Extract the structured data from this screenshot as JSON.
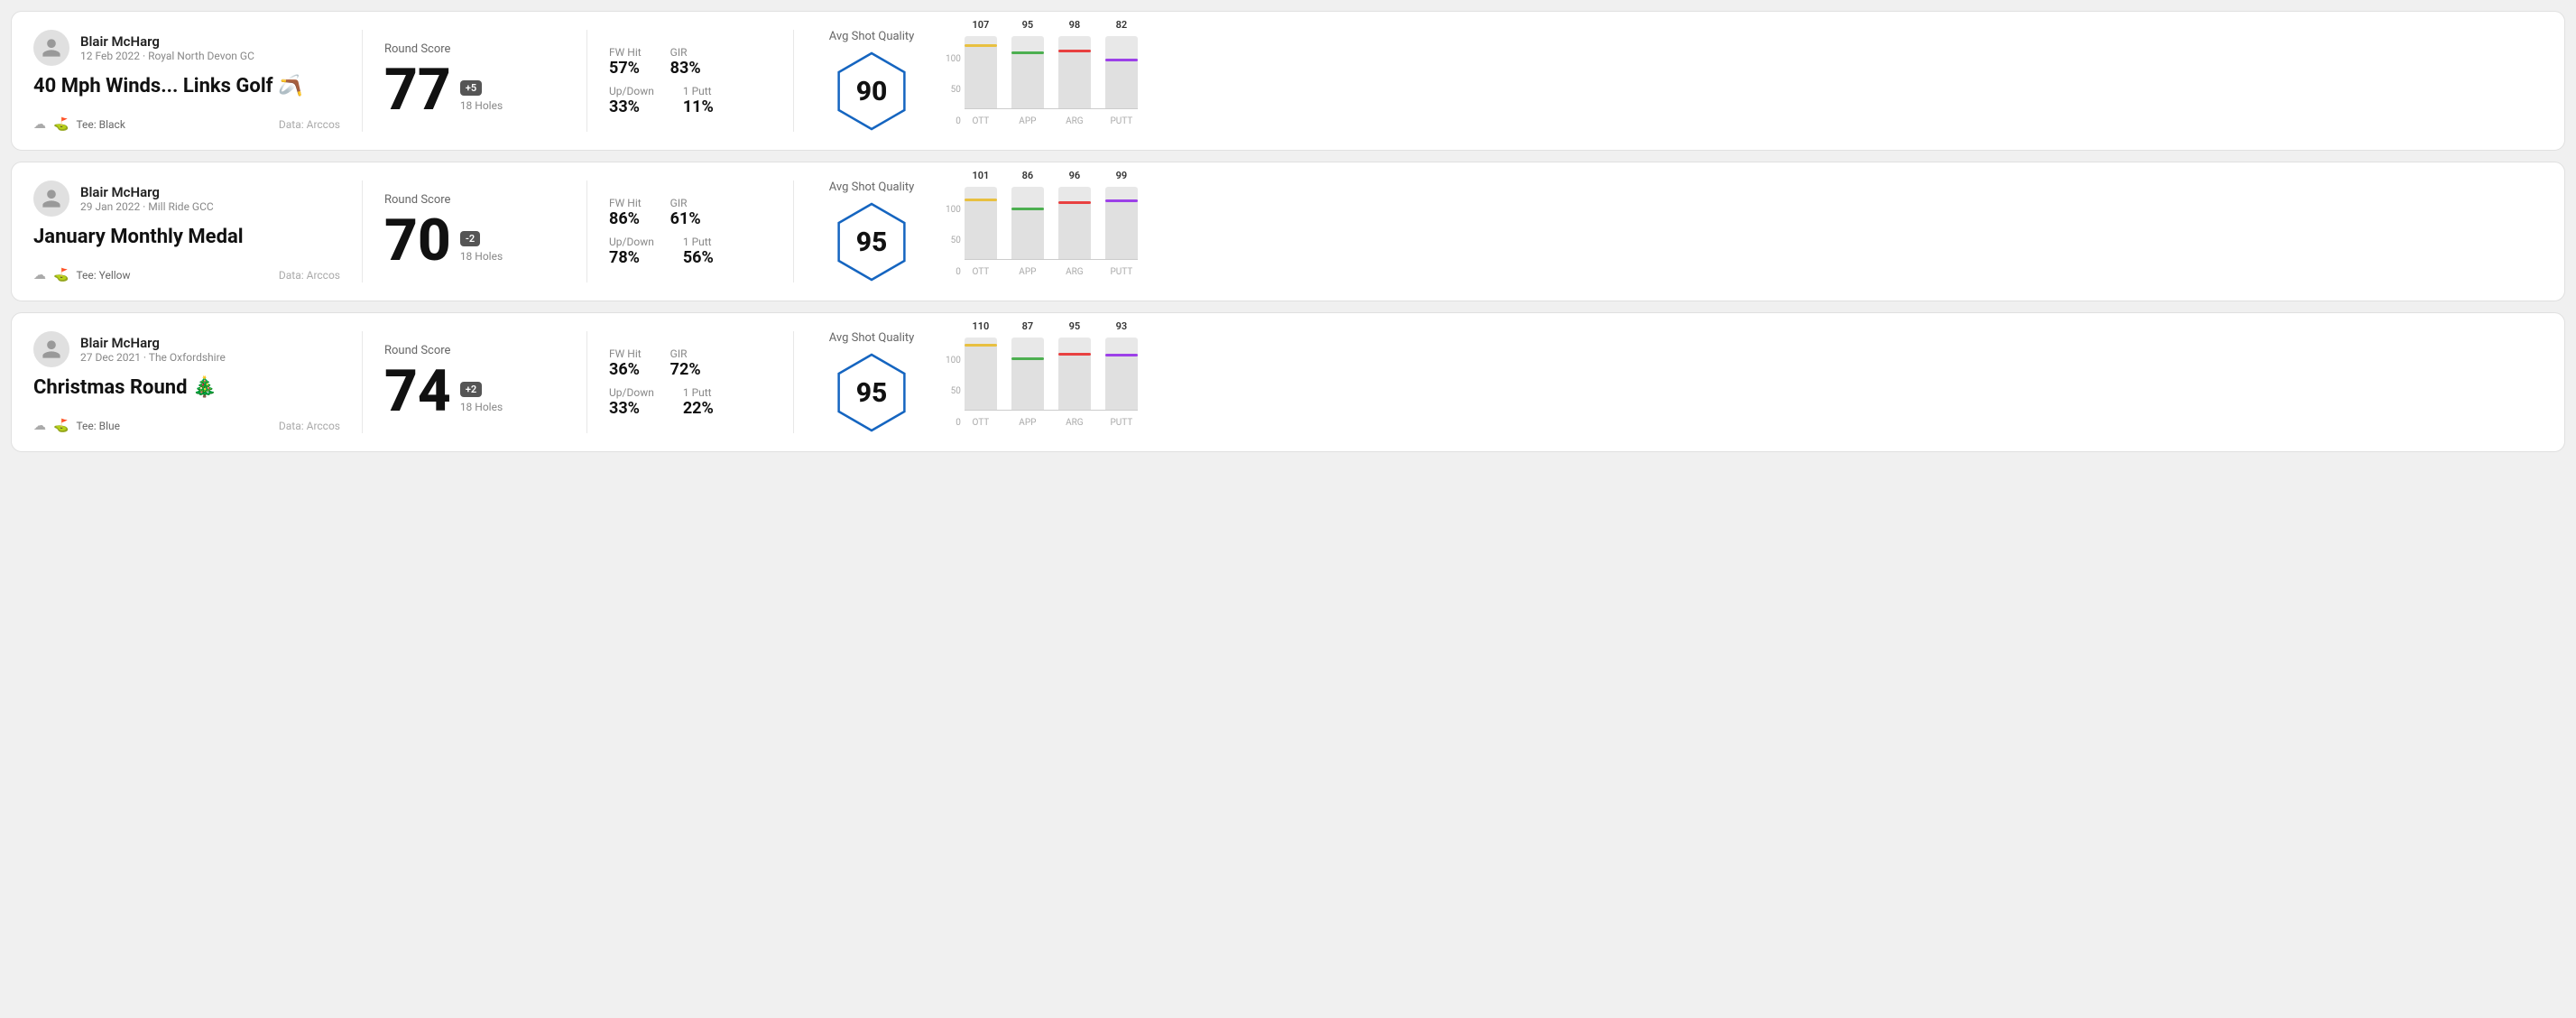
{
  "rounds": [
    {
      "id": "round-1",
      "player": {
        "name": "Blair McHarg",
        "date": "12 Feb 2022",
        "course": "Royal North Devon GC",
        "tee": "Black",
        "data_source": "Data: Arccos"
      },
      "title": "40 Mph Winds... Links Golf 🪃",
      "score": {
        "label": "Round Score",
        "value": "77",
        "badge": "+5",
        "badge_type": "positive",
        "holes": "18 Holes"
      },
      "stats": {
        "fw_hit_label": "FW Hit",
        "fw_hit_value": "57%",
        "gir_label": "GIR",
        "gir_value": "83%",
        "updown_label": "Up/Down",
        "updown_value": "33%",
        "oneputt_label": "1 Putt",
        "oneputt_value": "11%"
      },
      "quality": {
        "label": "Avg Shot Quality",
        "score": "90"
      },
      "chart": {
        "bars": [
          {
            "label": "OTT",
            "value": 107,
            "max": 120,
            "color": "#e8c040",
            "pct": 89
          },
          {
            "label": "APP",
            "value": 95,
            "max": 120,
            "color": "#4caf50",
            "pct": 79
          },
          {
            "label": "ARG",
            "value": 98,
            "max": 120,
            "color": "#e84040",
            "pct": 82
          },
          {
            "label": "PUTT",
            "value": 82,
            "max": 120,
            "color": "#9c40e8",
            "pct": 68
          }
        ],
        "y_labels": [
          "100",
          "50",
          "0"
        ]
      }
    },
    {
      "id": "round-2",
      "player": {
        "name": "Blair McHarg",
        "date": "29 Jan 2022",
        "course": "Mill Ride GCC",
        "tee": "Yellow",
        "data_source": "Data: Arccos"
      },
      "title": "January Monthly Medal",
      "score": {
        "label": "Round Score",
        "value": "70",
        "badge": "-2",
        "badge_type": "negative",
        "holes": "18 Holes"
      },
      "stats": {
        "fw_hit_label": "FW Hit",
        "fw_hit_value": "86%",
        "gir_label": "GIR",
        "gir_value": "61%",
        "updown_label": "Up/Down",
        "updown_value": "78%",
        "oneputt_label": "1 Putt",
        "oneputt_value": "56%"
      },
      "quality": {
        "label": "Avg Shot Quality",
        "score": "95"
      },
      "chart": {
        "bars": [
          {
            "label": "OTT",
            "value": 101,
            "max": 120,
            "color": "#e8c040",
            "pct": 84
          },
          {
            "label": "APP",
            "value": 86,
            "max": 120,
            "color": "#4caf50",
            "pct": 72
          },
          {
            "label": "ARG",
            "value": 96,
            "max": 120,
            "color": "#e84040",
            "pct": 80
          },
          {
            "label": "PUTT",
            "value": 99,
            "max": 120,
            "color": "#9c40e8",
            "pct": 83
          }
        ],
        "y_labels": [
          "100",
          "50",
          "0"
        ]
      }
    },
    {
      "id": "round-3",
      "player": {
        "name": "Blair McHarg",
        "date": "27 Dec 2021",
        "course": "The Oxfordshire",
        "tee": "Blue",
        "data_source": "Data: Arccos"
      },
      "title": "Christmas Round 🎄",
      "score": {
        "label": "Round Score",
        "value": "74",
        "badge": "+2",
        "badge_type": "positive",
        "holes": "18 Holes"
      },
      "stats": {
        "fw_hit_label": "FW Hit",
        "fw_hit_value": "36%",
        "gir_label": "GIR",
        "gir_value": "72%",
        "updown_label": "Up/Down",
        "updown_value": "33%",
        "oneputt_label": "1 Putt",
        "oneputt_value": "22%"
      },
      "quality": {
        "label": "Avg Shot Quality",
        "score": "95"
      },
      "chart": {
        "bars": [
          {
            "label": "OTT",
            "value": 110,
            "max": 120,
            "color": "#e8c040",
            "pct": 92
          },
          {
            "label": "APP",
            "value": 87,
            "max": 120,
            "color": "#4caf50",
            "pct": 73
          },
          {
            "label": "ARG",
            "value": 95,
            "max": 120,
            "color": "#e84040",
            "pct": 79
          },
          {
            "label": "PUTT",
            "value": 93,
            "max": 120,
            "color": "#9c40e8",
            "pct": 78
          }
        ],
        "y_labels": [
          "100",
          "50",
          "0"
        ]
      }
    }
  ]
}
